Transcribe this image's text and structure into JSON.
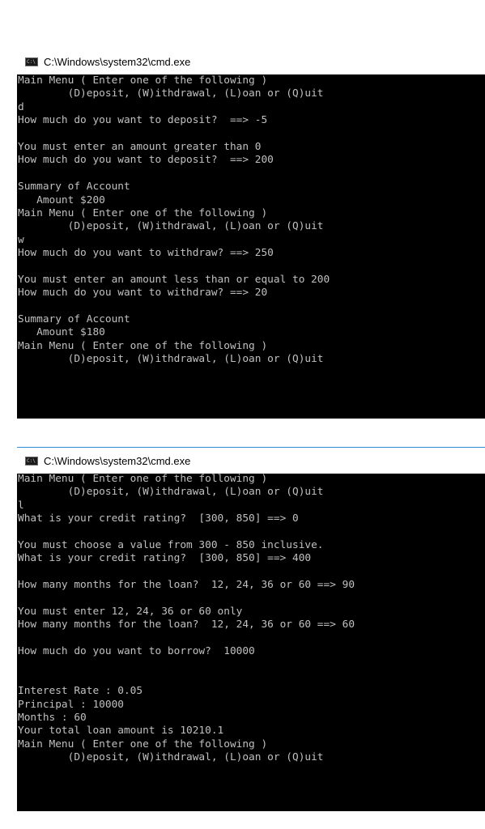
{
  "windows": [
    {
      "title": "C:\\Windows\\system32\\cmd.exe",
      "icon": "cmd-icon",
      "lines": [
        "Main Menu ( Enter one of the following )",
        "        (D)eposit, (W)ithdrawal, (L)oan or (Q)uit",
        "d",
        "How much do you want to deposit?  ==> -5",
        "",
        "You must enter an amount greater than 0",
        "How much do you want to deposit?  ==> 200",
        "",
        "Summary of Account",
        "   Amount $200",
        "Main Menu ( Enter one of the following )",
        "        (D)eposit, (W)ithdrawal, (L)oan or (Q)uit",
        "w",
        "How much do you want to withdraw? ==> 250",
        "",
        "You must enter an amount less than or equal to 200",
        "How much do you want to withdraw? ==> 20",
        "",
        "Summary of Account",
        "   Amount $180",
        "Main Menu ( Enter one of the following )",
        "        (D)eposit, (W)ithdrawal, (L)oan or (Q)uit"
      ]
    },
    {
      "title": "C:\\Windows\\system32\\cmd.exe",
      "icon": "cmd-icon",
      "lines": [
        "Main Menu ( Enter one of the following )",
        "        (D)eposit, (W)ithdrawal, (L)oan or (Q)uit",
        "l",
        "What is your credit rating?  [300, 850] ==> 0",
        "",
        "You must choose a value from 300 - 850 inclusive.",
        "What is your credit rating?  [300, 850] ==> 400",
        "",
        "How many months for the loan?  12, 24, 36 or 60 ==> 90",
        "",
        "You must enter 12, 24, 36 or 60 only",
        "How many months for the loan?  12, 24, 36 or 60 ==> 60",
        "",
        "How much do you want to borrow?  10000",
        "",
        "",
        "Interest Rate : 0.05",
        "Principal : 10000",
        "Months : 60",
        "Your total loan amount is 10210.1",
        "Main Menu ( Enter one of the following )",
        "        (D)eposit, (W)ithdrawal, (L)oan or (Q)uit"
      ]
    }
  ]
}
